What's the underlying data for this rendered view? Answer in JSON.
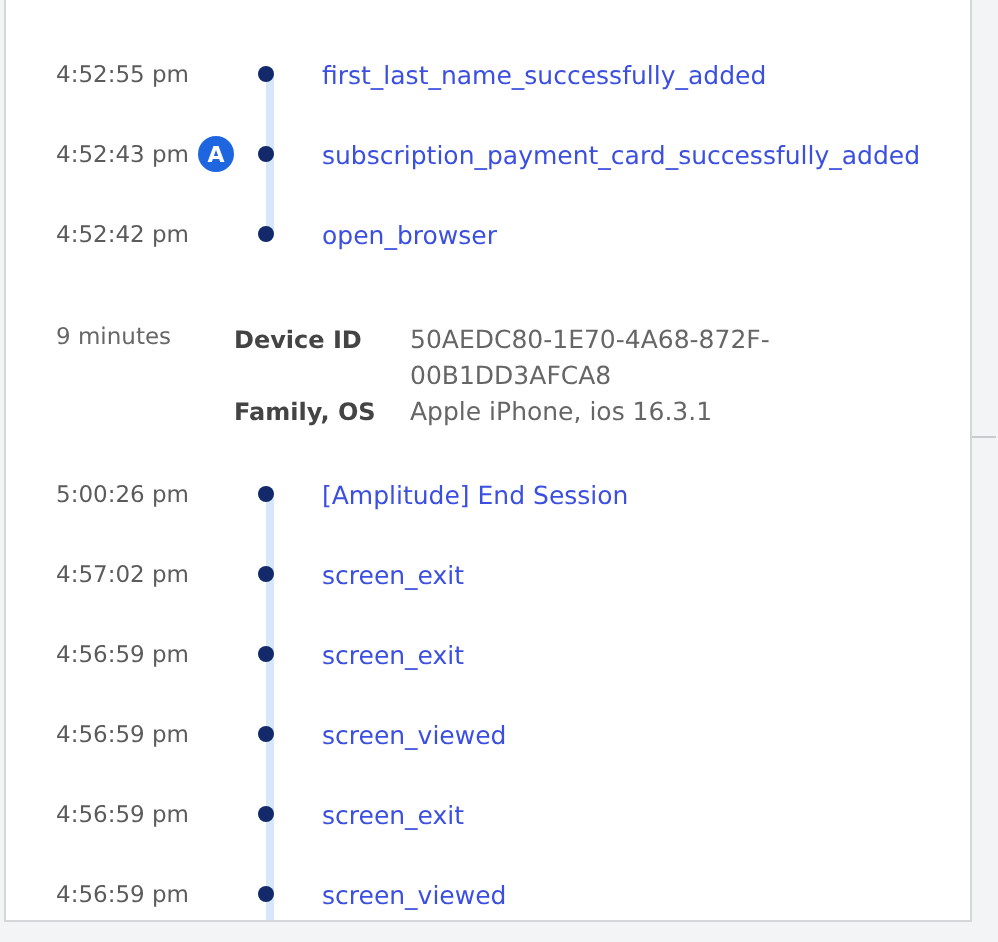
{
  "sessions": [
    {
      "events": [
        {
          "time": "4:52:55 pm",
          "name": "first_last_name_successfully_added"
        },
        {
          "time": "4:52:43 pm",
          "badge": "A",
          "name": "subscription_payment_card_successfully_added"
        },
        {
          "time": "4:52:42 pm",
          "name": "open_browser"
        }
      ]
    },
    {
      "duration": "9 minutes",
      "properties": [
        {
          "label": "Device ID",
          "value": "50AEDC80-1E70-4A68-872F-00B1DD3AFCA8"
        },
        {
          "label": "Family, OS",
          "value": "Apple iPhone, ios 16.3.1"
        }
      ],
      "events": [
        {
          "time": "5:00:26 pm",
          "name": "[Amplitude] End Session"
        },
        {
          "time": "4:57:02 pm",
          "name": "screen_exit"
        },
        {
          "time": "4:56:59 pm",
          "name": "screen_exit"
        },
        {
          "time": "4:56:59 pm",
          "name": "screen_viewed"
        },
        {
          "time": "4:56:59 pm",
          "name": "screen_exit"
        },
        {
          "time": "4:56:59 pm",
          "name": "screen_viewed"
        }
      ]
    }
  ]
}
